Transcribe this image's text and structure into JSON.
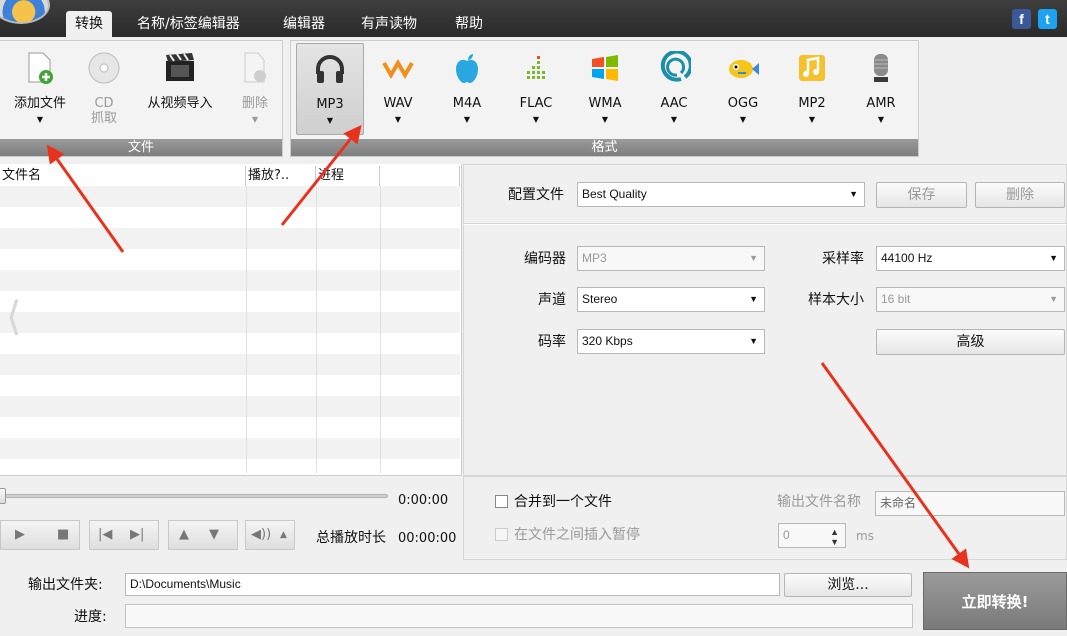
{
  "menu": {
    "tabs": [
      "转换",
      "名称/标签编辑器",
      "编辑器",
      "有声读物",
      "帮助"
    ]
  },
  "social": {
    "facebook": "f",
    "twitter": "t"
  },
  "ribbon": {
    "file_group": {
      "label": "文件",
      "buttons": [
        {
          "label": "添加文件"
        },
        {
          "label": "CD",
          "label2": "抓取"
        },
        {
          "label": "从视频导入"
        },
        {
          "label": "删除"
        }
      ]
    },
    "format_group": {
      "label": "格式",
      "formats": [
        "MP3",
        "WAV",
        "M4A",
        "FLAC",
        "WMA",
        "AAC",
        "OGG",
        "MP2",
        "AMR"
      ]
    }
  },
  "filelist": {
    "columns": [
      "文件名",
      "播放?..",
      "进程"
    ]
  },
  "player": {
    "position": "0:00:00",
    "total_label": "总播放时长",
    "total": "00:00:00"
  },
  "settings": {
    "profile_label": "配置文件",
    "profile": "Best Quality",
    "save": "保存",
    "delete": "删除",
    "encoder_label": "编码器",
    "encoder": "MP3",
    "channel_label": "声道",
    "channel": "Stereo",
    "bitrate_label": "码率",
    "bitrate": "320 Kbps",
    "samplerate_label": "采样率",
    "samplerate": "44100 Hz",
    "samplesize_label": "样本大小",
    "samplesize": "16 bit",
    "advanced": "高级"
  },
  "merge": {
    "merge_label": "合并到一个文件",
    "pause_label": "在文件之间插入暂停",
    "output_name_label": "输出文件名称",
    "output_name": "未命名",
    "pause_value": "0",
    "unit": "ms"
  },
  "output": {
    "folder_label": "输出文件夹:",
    "folder": "D:\\Documents\\Music",
    "browse": "浏览...",
    "progress_label": "进度:",
    "convert": "立即转换!"
  },
  "colors": {
    "accent_arrow": "#e8321e",
    "topbar": "#333333"
  }
}
